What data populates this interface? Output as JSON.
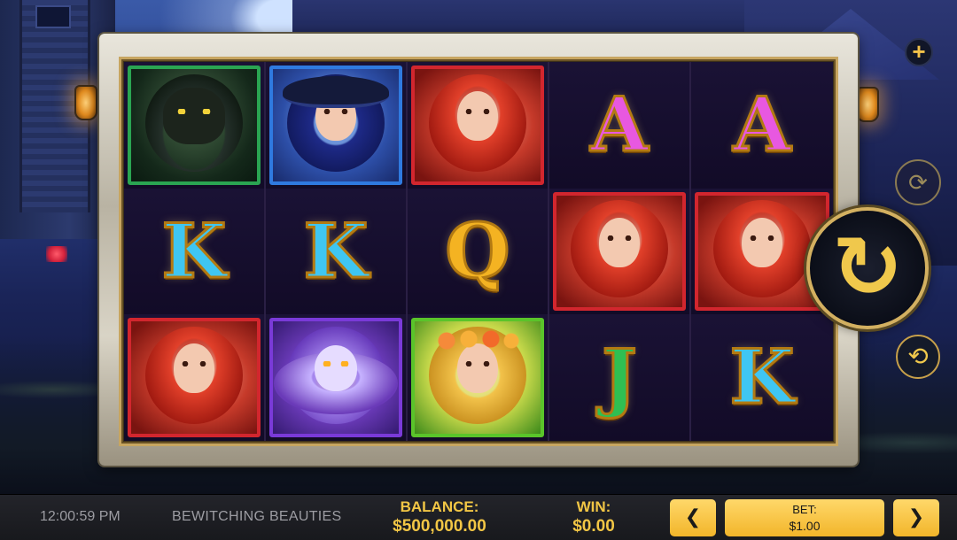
{
  "game": {
    "title": "BEWITCHING BEAUTIES"
  },
  "status_bar": {
    "clock": "12:00:59 PM",
    "balance_label": "BALANCE:",
    "balance_value": "$500,000.00",
    "win_label": "WIN:",
    "win_value": "$0.00",
    "bet_label": "BET:",
    "bet_value": "$1.00",
    "bet_decrease_icon": "❮",
    "bet_increase_icon": "❯"
  },
  "controls": {
    "spin_icon": "spin-arrow-icon",
    "spin_glyph": "↻",
    "autoplay_icon": "autoplay-icon",
    "autoplay_glyph": "⟳",
    "replay_icon": "refresh-icon",
    "replay_glyph": "⟲",
    "expand_icon": "plus-icon",
    "expand_glyph": "+"
  },
  "reels": {
    "grid": [
      [
        "cat",
        "witch",
        "redhead",
        "A",
        "A"
      ],
      [
        "K",
        "K",
        "Q",
        "redhead",
        "redhead"
      ],
      [
        "redhead",
        "owl",
        "fairy",
        "J",
        "K"
      ]
    ]
  },
  "colors": {
    "accent_gold": "#f2c645",
    "bar_bg": "#1e1f24",
    "letter_A": "#e858e0",
    "letter_K": "#3fc6f2",
    "letter_Q": "#f4b322",
    "letter_J": "#2fbf52"
  }
}
